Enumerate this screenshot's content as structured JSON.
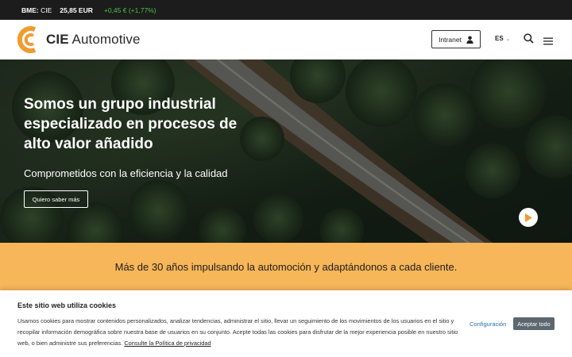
{
  "ticker": {
    "bme_label": "BME:",
    "symbol": "CIE",
    "price": "25,85 EUR",
    "change": "+0,45 € (+1,77%)"
  },
  "header": {
    "logo_bold": "CIE",
    "logo_rest": "Automotive",
    "intranet_label": "Intranet",
    "language": "ES",
    "icons": [
      "user-icon",
      "chevron-down-icon",
      "search-icon",
      "hamburger-menu-icon",
      "cie-logo-icon"
    ]
  },
  "hero": {
    "title": "Somos un grupo industrial especializado en procesos de alto valor añadido",
    "subtitle": "Comprometidos con la eficiencia y la calidad",
    "cta_label": "Quiero saber más",
    "play_icon": "play-icon"
  },
  "band": {
    "text": "Más de 30 años impulsando la automoción y adaptándonos a cada cliente."
  },
  "cookies": {
    "title": "Este sitio web utiliza cookies",
    "body": "Usamos cookies para mostrar contenidos personalizados, analizar tendencias, administrar el sitio, llevar un seguimiento de los movimientos de los usuarios en el sitio y recopilar información demográfica sobre nuestra base de usuarios en su conjunto. Acepte todas las cookies para disfrutar de la mejor experiencia posible en nuestro sitio web, o bien administre sus preferencias.",
    "policy_link": "Consulte la Política de privacidad",
    "config_label": "Configuración",
    "accept_label": "Aceptar todo"
  },
  "colors": {
    "ticker_bg": "#1c1c1c",
    "ticker_positive": "#4cc04c",
    "brand_orange": "#f29a2e",
    "band_bg": "#f7b65a",
    "accept_bg": "#5d6770",
    "link_blue": "#2b6fb0"
  }
}
